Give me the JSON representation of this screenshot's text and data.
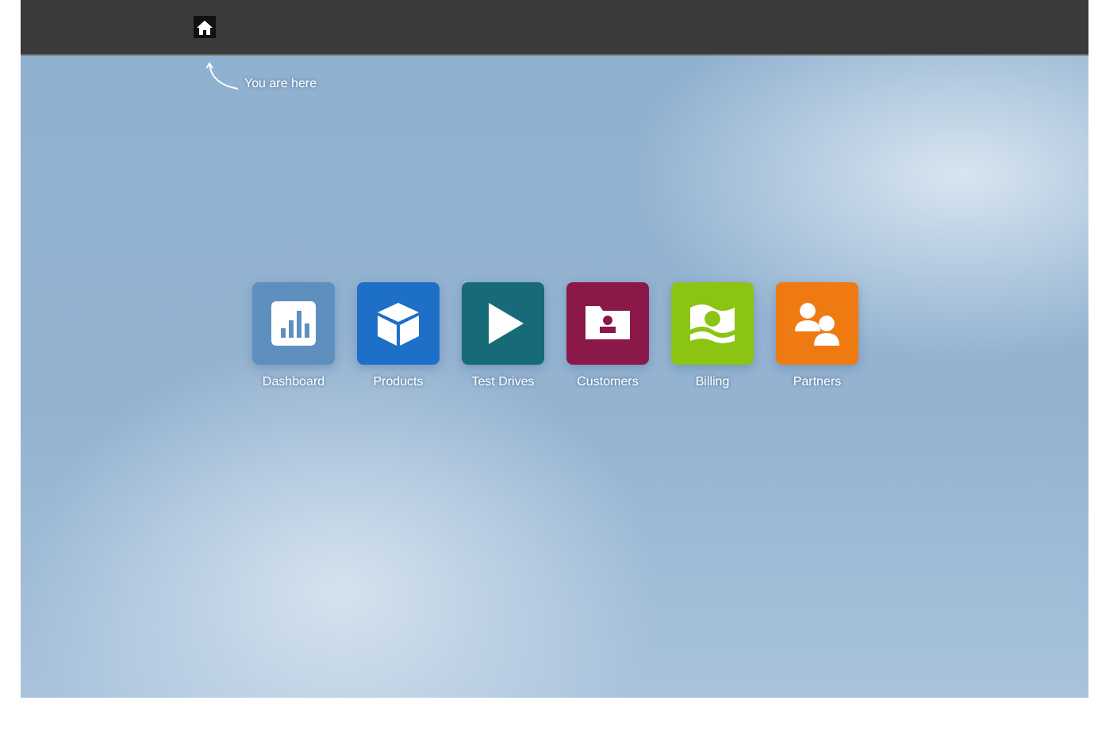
{
  "top_bar": {
    "hint": "You are here"
  },
  "tiles": [
    {
      "kind": "chart",
      "label": "Dashboard",
      "color": "#5f8fbf"
    },
    {
      "kind": "box",
      "label": "Products",
      "color": "#1e6fc8"
    },
    {
      "kind": "play",
      "label": "Test Drives",
      "color": "#176a78"
    },
    {
      "kind": "folder",
      "label": "Customers",
      "color": "#8a1848"
    },
    {
      "kind": "money",
      "label": "Billing",
      "color": "#8cc414"
    },
    {
      "kind": "people",
      "label": "Partners",
      "color": "#ef7a12"
    }
  ]
}
